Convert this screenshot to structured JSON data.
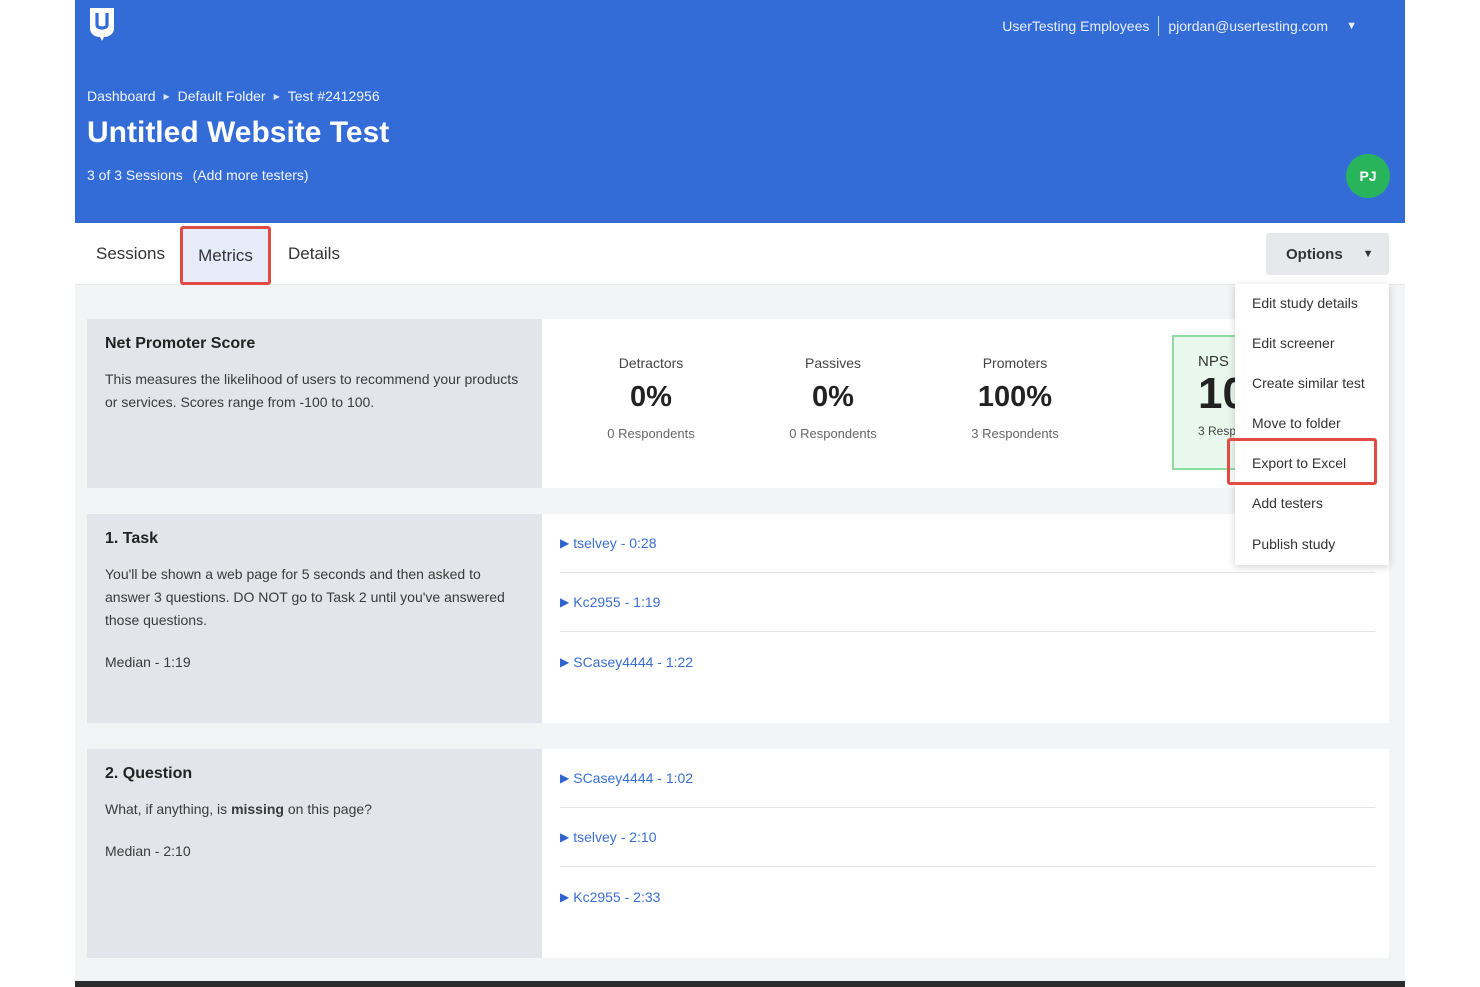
{
  "header": {
    "org": "UserTesting Employees",
    "email": "pjordan@usertesting.com",
    "breadcrumb": [
      "Dashboard",
      "Default Folder",
      "Test #2412956"
    ],
    "title": "Untitled Website Test",
    "sessions_count": "3 of 3 Sessions",
    "add_testers": "(Add more testers)",
    "avatar_initials": "PJ",
    "colors": {
      "banner": "#336bd7",
      "avatar": "#27b45a"
    }
  },
  "tabs": [
    {
      "label": "Sessions",
      "active": false
    },
    {
      "label": "Metrics",
      "active": true
    },
    {
      "label": "Details",
      "active": false
    }
  ],
  "options": {
    "label": "Options",
    "menu": [
      "Edit study details",
      "Edit screener",
      "Create similar test",
      "Move to folder",
      "Export to Excel",
      "Add testers",
      "Publish study"
    ],
    "highlighted": "Export to Excel"
  },
  "nps": {
    "title": "Net Promoter Score",
    "description": "This measures the likelihood of users to recommend your products or services. Scores range from -100 to 100.",
    "stats": [
      {
        "label": "Detractors",
        "value": "0%",
        "respondents": "0 Respondents"
      },
      {
        "label": "Passives",
        "value": "0%",
        "respondents": "0 Respondents"
      },
      {
        "label": "Promoters",
        "value": "100%",
        "respondents": "3 Respondents"
      }
    ],
    "score_label": "NPS",
    "score_value": "100",
    "score_respondents": "3 Respondents"
  },
  "task": {
    "title": "1. Task",
    "description": "You'll be shown a web page for 5 seconds and then asked to answer 3 questions. DO NOT go to Task 2 until you've answered those questions.",
    "median": "Median - 1:19",
    "sessions": [
      "tselvey - 0:28",
      "Kc2955 - 1:19",
      "SCasey4444 - 1:22"
    ]
  },
  "question": {
    "title": "2. Question",
    "prefix": "What, if anything, is",
    "bold": "missing",
    "suffix": "on this page?",
    "median": "Median - 2:10",
    "sessions": [
      "SCasey4444 - 1:02",
      "tselvey - 2:10",
      "Kc2955 - 2:33"
    ]
  }
}
